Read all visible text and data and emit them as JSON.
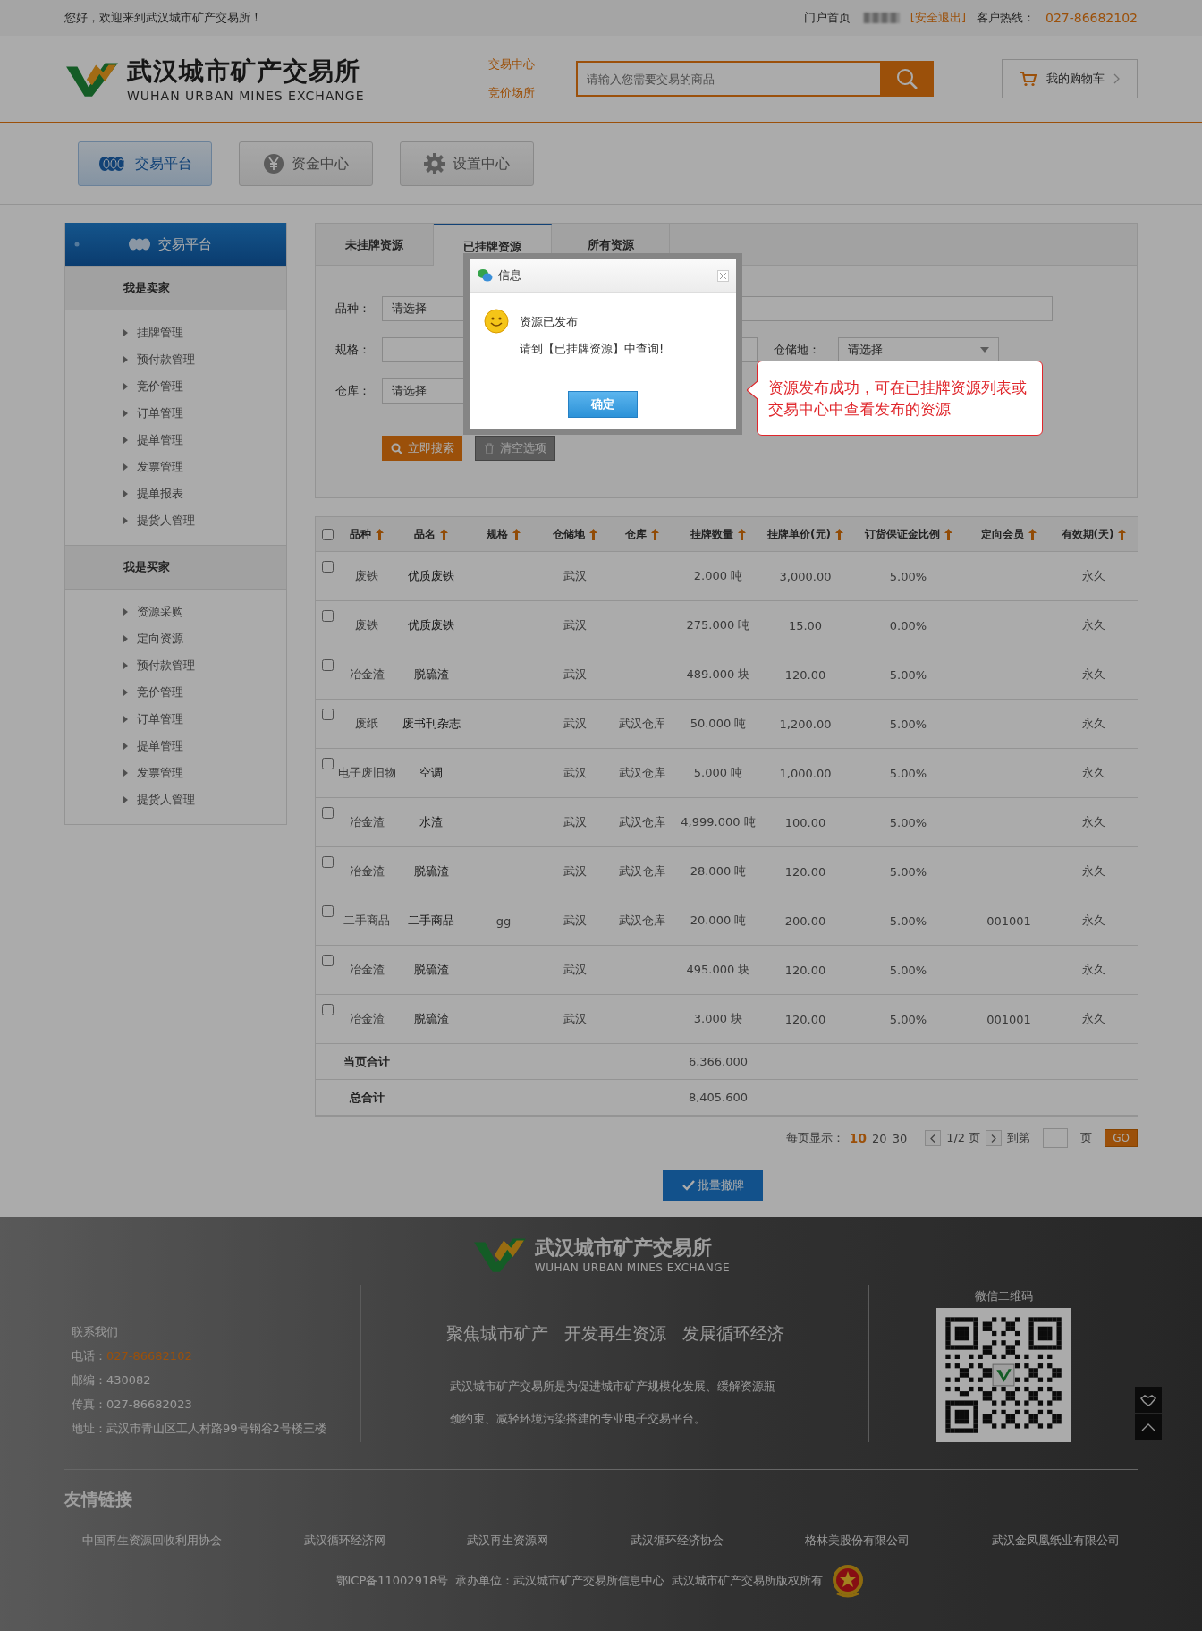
{
  "top_bar": {
    "greeting": "您好，欢迎来到武汉城市矿产交易所！",
    "home_link": "门户首页",
    "logout_link": "[安全退出]",
    "hotline_label": "客户热线：",
    "hotline": "027-86682102"
  },
  "header": {
    "logo_cn": "武汉城市矿产交易所",
    "logo_en": "WUHAN URBAN MINES EXCHANGE",
    "nav_links": [
      "交易中心",
      "竞价场所"
    ],
    "search": {
      "placeholder": "请输入您需要交易的商品"
    },
    "cart": "我的购物车"
  },
  "main_tabs": [
    {
      "label": "交易平台",
      "selected": true
    },
    {
      "label": "资金中心",
      "selected": false
    },
    {
      "label": "设置中心",
      "selected": false
    }
  ],
  "sidebar": {
    "title": "交易平台",
    "sections": [
      {
        "title": "我是卖家",
        "items": [
          "挂牌管理",
          "预付款管理",
          "竞价管理",
          "订单管理",
          "提单管理",
          "发票管理",
          "提单报表",
          "提货人管理"
        ]
      },
      {
        "title": "我是买家",
        "items": [
          "资源采购",
          "定向资源",
          "预付款管理",
          "竞价管理",
          "订单管理",
          "提单管理",
          "发票管理",
          "提货人管理"
        ]
      }
    ]
  },
  "resource_tabs": [
    {
      "label": "未挂牌资源",
      "selected": false
    },
    {
      "label": "已挂牌资源",
      "selected": true
    },
    {
      "label": "所有资源",
      "selected": false
    }
  ],
  "filter_form": {
    "variety": {
      "label": "品种：",
      "value": "请选择"
    },
    "spec": {
      "label": "规格："
    },
    "storage": {
      "label": "仓储地：",
      "value": "请选择"
    },
    "warehouse": {
      "label": "仓库：",
      "value": "请选择"
    },
    "search_button": "立即搜索",
    "clear_button": "清空选项"
  },
  "table": {
    "select_all_checked": false,
    "columns": [
      "品种",
      "品名",
      "规格",
      "仓储地",
      "仓库",
      "挂牌数量",
      "挂牌单价(元)",
      "订货保证金比例",
      "定向会员",
      "有效期(天)"
    ],
    "rows": [
      {
        "checked": false,
        "cells": [
          "废铁",
          "优质废铁",
          null,
          "武汉",
          null,
          "2.000 吨",
          "3,000.00",
          "5.00%",
          null,
          "永久"
        ]
      },
      {
        "checked": false,
        "cells": [
          "废铁",
          "优质废铁",
          null,
          "武汉",
          null,
          "275.000 吨",
          "15.00",
          "0.00%",
          null,
          "永久"
        ]
      },
      {
        "checked": false,
        "cells": [
          "冶金渣",
          "脱硫渣",
          null,
          "武汉",
          null,
          "489.000 块",
          "120.00",
          "5.00%",
          null,
          "永久"
        ]
      },
      {
        "checked": false,
        "cells": [
          "废纸",
          "废书刊杂志",
          null,
          "武汉",
          "武汉仓库",
          "50.000 吨",
          "1,200.00",
          "5.00%",
          null,
          "永久"
        ]
      },
      {
        "checked": false,
        "cells": [
          "电子废旧物",
          "空调",
          null,
          "武汉",
          "武汉仓库",
          "5.000 吨",
          "1,000.00",
          "5.00%",
          null,
          "永久"
        ]
      },
      {
        "checked": false,
        "cells": [
          "冶金渣",
          "水渣",
          null,
          "武汉",
          "武汉仓库",
          "4,999.000 吨",
          "100.00",
          "5.00%",
          null,
          "永久"
        ]
      },
      {
        "checked": false,
        "cells": [
          "冶金渣",
          "脱硫渣",
          null,
          "武汉",
          "武汉仓库",
          "28.000 吨",
          "120.00",
          "5.00%",
          null,
          "永久"
        ]
      },
      {
        "checked": false,
        "cells": [
          "二手商品",
          "二手商品",
          "gg",
          "武汉",
          "武汉仓库",
          "20.000 吨",
          "200.00",
          "5.00%",
          "001001",
          "永久"
        ]
      },
      {
        "checked": false,
        "cells": [
          "冶金渣",
          "脱硫渣",
          null,
          "武汉",
          null,
          "495.000 块",
          "120.00",
          "5.00%",
          null,
          "永久"
        ]
      },
      {
        "checked": false,
        "cells": [
          "冶金渣",
          "脱硫渣",
          null,
          "武汉",
          null,
          "3.000 块",
          "120.00",
          "5.00%",
          "001001",
          "永久"
        ]
      }
    ],
    "totals": [
      {
        "label": "当页合计",
        "value": "6,366.000"
      },
      {
        "label": "总合计",
        "value": "8,405.600"
      }
    ]
  },
  "pagination": {
    "per_page_label": "每页显示：",
    "sizes": [
      {
        "label": "10",
        "selected": true
      },
      {
        "label": "20",
        "selected": false
      },
      {
        "label": "30",
        "selected": false
      }
    ],
    "page": "1/2 页",
    "goto_label": "到第",
    "page_suffix": "页",
    "go": "GO"
  },
  "batch_button": "批量撤牌",
  "footer": {
    "logo_cn": "武汉城市矿产交易所",
    "logo_en": "WUHAN URBAN MINES EXCHANGE",
    "contact_title": "联系我们",
    "phone_label": "电话：",
    "phone": "027-86682102",
    "postcode": "邮编：430082",
    "fax": "传真：027-86682023",
    "address": "地址：武汉市青山区工人村路99号钢谷2号楼三楼",
    "slogan": [
      "聚焦城市矿产",
      "开发再生资源",
      "发展循环经济"
    ],
    "description": "武汉城市矿产交易所是为促进城市矿产规模化发展、缓解资源瓶颈约束、减轻环境污染搭建的专业电子交易平台。",
    "qr_title": "微信二维码",
    "links_title": "友情链接",
    "links": [
      "中国再生资源回收利用协会",
      "武汉循环经济网",
      "武汉再生资源网",
      "武汉循环经济协会",
      "格林美股份有限公司",
      "武汉金凤凰纸业有限公司"
    ],
    "icp": "鄂ICP备11002918号",
    "organizer": "承办单位：武汉城市矿产交易所信息中心",
    "copyright": "武汉城市矿产交易所版权所有"
  },
  "dialog": {
    "title": "信息",
    "lines": [
      "资源已发布",
      "请到【已挂牌资源】中查询!"
    ],
    "ok": "确定"
  },
  "callout": "资源发布成功，可在已挂牌资源列表或交易中心中查看发布的资源"
}
